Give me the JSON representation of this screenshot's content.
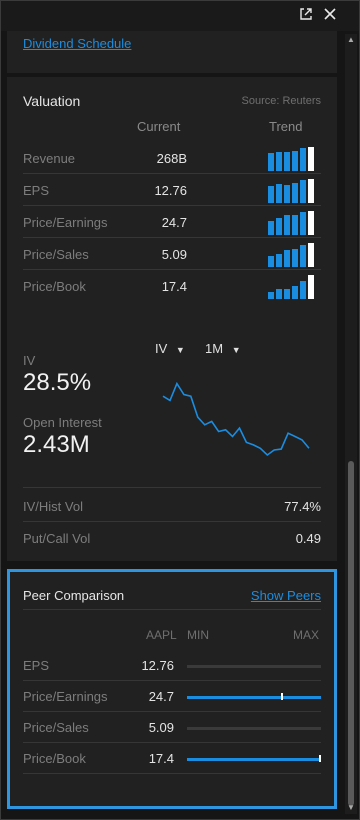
{
  "window": {
    "popout_icon": "external-link-icon",
    "close_icon": "close-icon"
  },
  "dividend": {
    "link": "Dividend Schedule"
  },
  "valuation": {
    "title": "Valuation",
    "source": "Source: Reuters",
    "col_current": "Current",
    "col_trend": "Trend",
    "rows": [
      {
        "label": "Revenue",
        "value": "268B",
        "trend": [
          0.75,
          0.8,
          0.8,
          0.85,
          0.95,
          1.0
        ]
      },
      {
        "label": "EPS",
        "value": "12.76",
        "trend": [
          0.7,
          0.8,
          0.75,
          0.85,
          0.95,
          1.0
        ]
      },
      {
        "label": "Price/Earnings",
        "value": "24.7",
        "trend": [
          0.6,
          0.7,
          0.85,
          0.85,
          0.95,
          1.0
        ]
      },
      {
        "label": "Price/Sales",
        "value": "5.09",
        "trend": [
          0.45,
          0.55,
          0.7,
          0.75,
          0.9,
          1.0
        ]
      },
      {
        "label": "Price/Book",
        "value": "17.4",
        "trend": [
          0.3,
          0.4,
          0.4,
          0.55,
          0.75,
          1.0
        ]
      }
    ]
  },
  "volatility": {
    "dropdown_metric": "IV",
    "dropdown_period": "1M",
    "iv_label": "IV",
    "iv_value": "28.5%",
    "oi_label": "Open Interest",
    "oi_value": "2.43M",
    "sparkline": [
      0.7,
      0.65,
      0.85,
      0.72,
      0.7,
      0.45,
      0.36,
      0.4,
      0.28,
      0.3,
      0.22,
      0.32,
      0.15,
      0.12,
      0.08,
      0.0,
      0.06,
      0.07,
      0.26,
      0.22,
      0.18,
      0.08
    ],
    "hist_label": "IV/Hist Vol",
    "hist_value": "77.4%",
    "putcall_label": "Put/Call Vol",
    "putcall_value": "0.49"
  },
  "peers": {
    "title": "Peer Comparison",
    "show_link": "Show Peers",
    "col_symbol": "AAPL",
    "col_min": "MIN",
    "col_max": "MAX",
    "rows": [
      {
        "label": "EPS",
        "value": "12.76",
        "has_range": false,
        "marker": null
      },
      {
        "label": "Price/Earnings",
        "value": "24.7",
        "has_range": true,
        "marker": 0.71
      },
      {
        "label": "Price/Sales",
        "value": "5.09",
        "has_range": false,
        "marker": null
      },
      {
        "label": "Price/Book",
        "value": "17.4",
        "has_range": true,
        "marker": 1.0
      }
    ]
  },
  "colors": {
    "accent": "#1b8de0",
    "highlight_border": "#2e95e0",
    "panel": "#212121",
    "background": "#151515"
  }
}
